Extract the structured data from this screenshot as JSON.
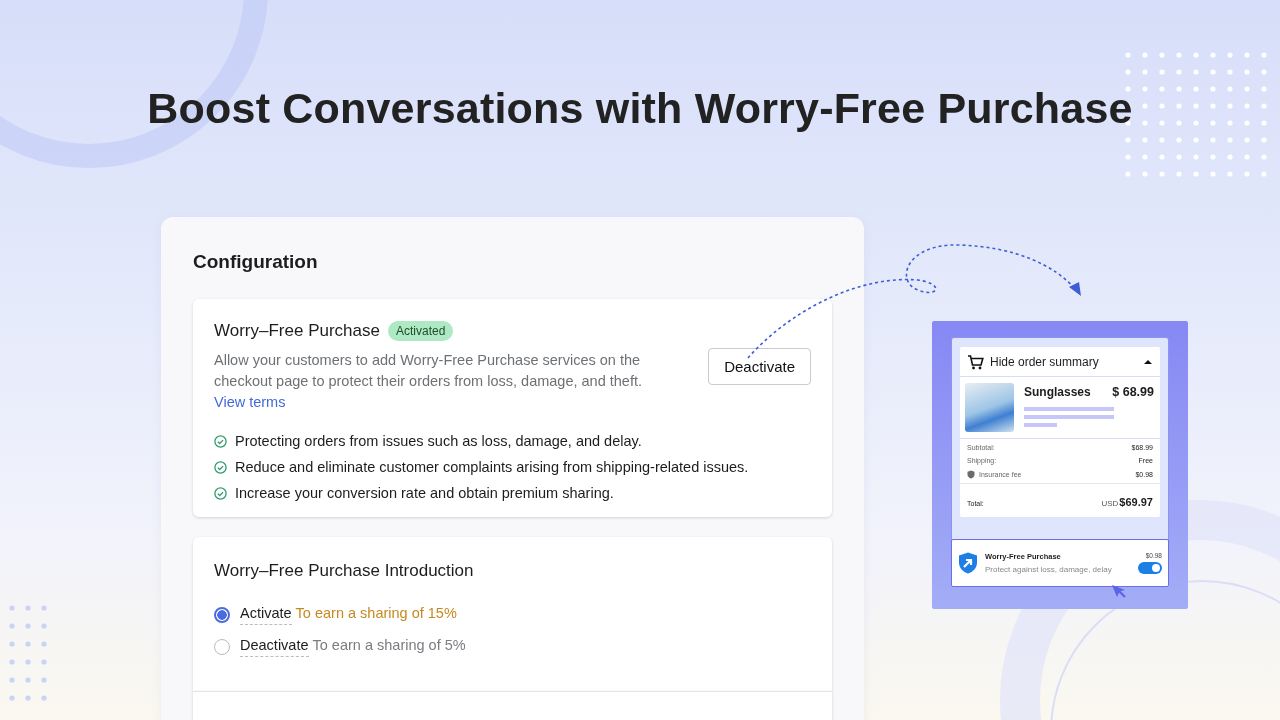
{
  "headline": "Boost Conversations with Worry-Free Purchase",
  "config": {
    "title": "Configuration",
    "service": {
      "name": "Worry–Free Purchase",
      "status": "Activated",
      "activated": true,
      "description": "Allow your customers to add Worry-Free Purchase services on the checkout page to protect their orders from loss, damage, and theft.",
      "link": "View terms",
      "button": "Deactivate",
      "benefits": [
        "Protecting orders from issues such as loss, damage, and delay.",
        "Reduce and eliminate customer complaints arising from shipping-related issues.",
        "Increase your conversion rate and obtain premium sharing."
      ]
    },
    "introduction": {
      "title": "Worry–Free Purchase Introduction",
      "options": [
        {
          "label": "Activate",
          "note": "To earn a sharing of 15%",
          "selected": true
        },
        {
          "label": "Deactivate",
          "note": "To earn a sharing of 5%",
          "selected": false
        }
      ]
    }
  },
  "preview": {
    "summary_toggle": "Hide order summary",
    "expanded": true,
    "product": {
      "name": "Sunglasses",
      "price": "$ 68.99"
    },
    "lines": [
      {
        "kind": "plain",
        "label": "Subtotal:",
        "value": "$68.99"
      },
      {
        "kind": "plain",
        "label": "Shipping:",
        "value": "Free"
      },
      {
        "kind": "insurance",
        "label": "Insurance fee",
        "value": "$0.98"
      }
    ],
    "total": {
      "label": "Total:",
      "currency": "USD",
      "amount": "$69.97"
    },
    "protection": {
      "title": "Worry-Free Purchase",
      "subtitle": "Protect against loss, damage, delay",
      "price": "$0.98",
      "on": true
    }
  }
}
